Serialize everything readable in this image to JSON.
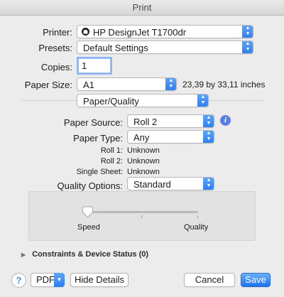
{
  "window": {
    "title": "Print"
  },
  "printer": {
    "label": "Printer:",
    "value": "HP DesignJet T1700dr"
  },
  "presets": {
    "label": "Presets:",
    "value": "Default Settings"
  },
  "copies": {
    "label": "Copies:",
    "value": "1"
  },
  "paper_size": {
    "label": "Paper Size:",
    "value": "A1",
    "dimensions": "23,39 by 33,11 inches"
  },
  "section": {
    "value": "Paper/Quality"
  },
  "paper_source": {
    "label": "Paper Source:",
    "value": "Roll 2"
  },
  "paper_type": {
    "label": "Paper Type:",
    "value": "Any"
  },
  "status": [
    {
      "label": "Roll 1:",
      "value": "Unknown"
    },
    {
      "label": "Roll 2:",
      "value": "Unknown"
    },
    {
      "label": "Single Sheet:",
      "value": "Unknown"
    }
  ],
  "quality_options": {
    "label": "Quality Options:",
    "value": "Standard"
  },
  "quality_slider": {
    "left_label": "Speed",
    "right_label": "Quality",
    "position": 0
  },
  "constraints": {
    "label": "Constraints & Device Status (0)"
  },
  "footer": {
    "help": "?",
    "pdf": "PDF",
    "hide_details": "Hide Details",
    "cancel": "Cancel",
    "save": "Save"
  },
  "icons": {
    "printer_status": "printer-icon",
    "info": "info-icon",
    "disclosure": "disclosure-triangle-icon"
  },
  "colors": {
    "accent": "#2d7ef1"
  }
}
